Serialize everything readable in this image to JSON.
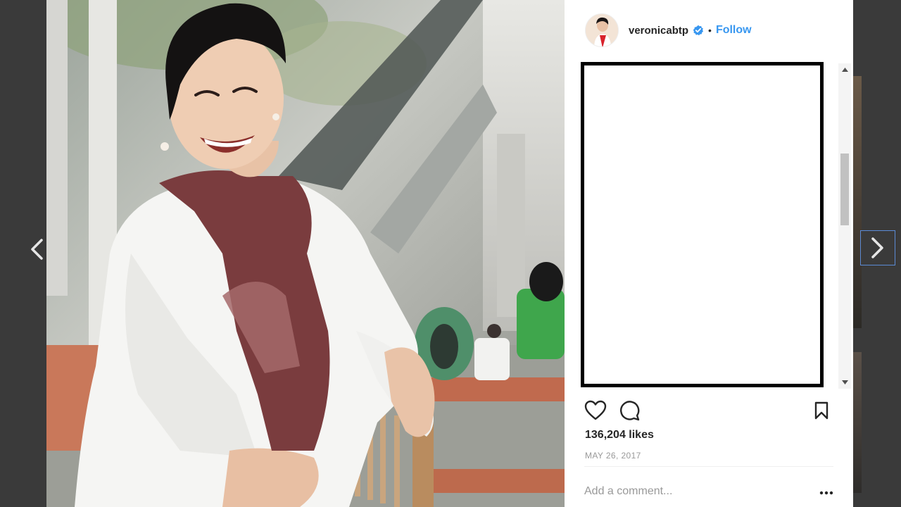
{
  "post": {
    "username": "veronicabtp",
    "separator": "•",
    "follow_label": "Follow",
    "likes": "136,204 likes",
    "date": "MAY 26, 2017"
  },
  "comment": {
    "placeholder": "Add a comment..."
  },
  "icons": {
    "prev": "chevron-left-icon",
    "next": "chevron-right-icon",
    "like": "heart-icon",
    "comment": "comment-icon",
    "save": "bookmark-icon",
    "verified": "verified-badge-icon",
    "more": "more-options-icon"
  },
  "colors": {
    "accent": "#3897f0",
    "text": "#262626",
    "muted": "#999999",
    "backdrop": "#3a3a3a"
  }
}
